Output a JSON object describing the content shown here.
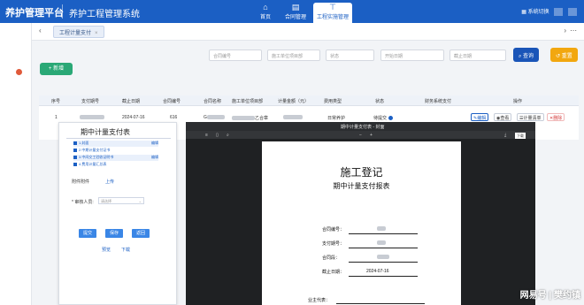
{
  "header": {
    "brand": "养护管理平台",
    "subtitle": "养护工程管理系统",
    "nav": [
      {
        "label": "首页",
        "icon": "home-icon"
      },
      {
        "label": "合同管理",
        "icon": "contract-icon"
      },
      {
        "label": "工程实施管理",
        "icon": "crane-icon"
      }
    ],
    "system_switch": "系统切换"
  },
  "tabs": {
    "active_tab": "工程计量支付",
    "close": "×"
  },
  "filters": {
    "contract_name": "合同编号",
    "unit_name": "施工单位项目部",
    "status": "状态",
    "start_date": "开始日期",
    "end_date": "截止日期",
    "query": "查询",
    "reset": "重置"
  },
  "add_button": "+ 新增",
  "table": {
    "headers": [
      "序号",
      "支付期号",
      "截止日期",
      "合同编号",
      "合同名称",
      "施工单位项目部",
      "计量金额（元）",
      "费用类型",
      "状态",
      "财务系统支付",
      "操作"
    ],
    "row": {
      "index": "1",
      "end_date": "2024-07-16",
      "contract_no": "616",
      "contract_name": "G",
      "unit": "乙合章",
      "amount": "",
      "fee_type": "日常养护",
      "status": "待提交",
      "actions": {
        "edit": "编辑",
        "view": "查看",
        "measure": "计量清单",
        "delete": "删除"
      }
    }
  },
  "form_panel": {
    "title": "期中计量支付表",
    "docs": [
      {
        "label": "1.封面",
        "action": "编辑",
        "striped": true
      },
      {
        "label": "2.中期计量支付证书",
        "action": "",
        "striped": false
      },
      {
        "label": "3.中间交工验收证明书",
        "action": "编辑",
        "striped": true
      },
      {
        "label": "4.费用计量汇总表",
        "action": "",
        "striped": false
      }
    ],
    "attachments_label": "附件附件",
    "upload": "上传",
    "approver_label": "* 审核人员:",
    "approver_placeholder": "请选择",
    "buttons": {
      "submit": "提交",
      "save": "保存",
      "back": "返回"
    },
    "preview": "预览",
    "download": "下载"
  },
  "viewer": {
    "title": "期中计量支付表 - 封面",
    "download_tip": "下载",
    "doc_title": "施工登记",
    "doc_subtitle": "期中计量支付报表",
    "fields": [
      {
        "key": "合同编号：",
        "value": ""
      },
      {
        "key": "支付期号：",
        "value": ""
      },
      {
        "key": "合同段：",
        "value": ""
      },
      {
        "key": "截止日期：",
        "value": "2024-07-16"
      }
    ],
    "signer_label": "业主代表："
  },
  "watermark": "网易号 | 樊约镇",
  "colors": {
    "primary": "#1b5fc4",
    "success": "#2aa876",
    "query_btn": "#1a55b8",
    "reset_btn": "#f2a70f",
    "danger": "#d43a3a"
  }
}
